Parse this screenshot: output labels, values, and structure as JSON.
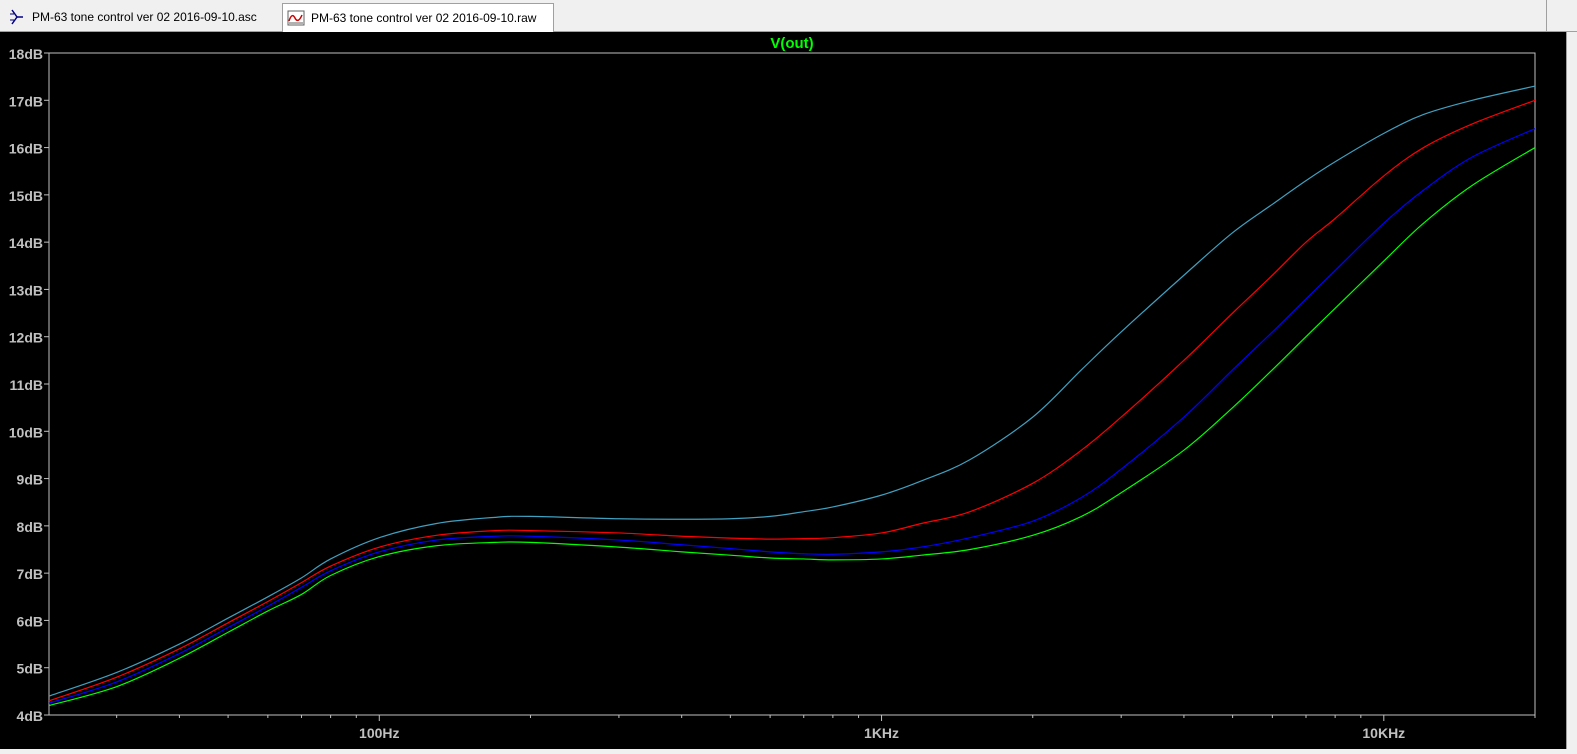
{
  "tabs": [
    {
      "label": "PM-63 tone control ver 02 2016-09-10.asc",
      "icon": "schematic-icon",
      "active": false
    },
    {
      "label": "PM-63 tone control ver 02 2016-09-10.raw",
      "icon": "waveform-icon",
      "active": true
    }
  ],
  "colors": {
    "plot_background": "#000000",
    "axis_color": "#c0c0c0",
    "tick_label_color": "#c0c0c0",
    "title_color": "#00ff00"
  },
  "chart_data": {
    "type": "line",
    "title": "V(out)",
    "xscale": "log",
    "xlim": [
      22,
      20000
    ],
    "ylim": [
      4,
      18
    ],
    "grid": false,
    "x_ticks": [
      {
        "value": 100,
        "label": "100Hz"
      },
      {
        "value": 1000,
        "label": "1KHz"
      },
      {
        "value": 10000,
        "label": "10KHz"
      }
    ],
    "y_ticks": [
      {
        "value": 4,
        "label": "4dB"
      },
      {
        "value": 5,
        "label": "5dB"
      },
      {
        "value": 6,
        "label": "6dB"
      },
      {
        "value": 7,
        "label": "7dB"
      },
      {
        "value": 8,
        "label": "8dB"
      },
      {
        "value": 9,
        "label": "9dB"
      },
      {
        "value": 10,
        "label": "10dB"
      },
      {
        "value": 11,
        "label": "11dB"
      },
      {
        "value": 12,
        "label": "12dB"
      },
      {
        "value": 13,
        "label": "13dB"
      },
      {
        "value": 14,
        "label": "14dB"
      },
      {
        "value": 15,
        "label": "15dB"
      },
      {
        "value": 16,
        "label": "16dB"
      },
      {
        "value": 17,
        "label": "17dB"
      },
      {
        "value": 18,
        "label": "18dB"
      }
    ],
    "series": [
      {
        "color": "#40a0c0",
        "points": [
          [
            22,
            4.4
          ],
          [
            30,
            4.9
          ],
          [
            40,
            5.5
          ],
          [
            50,
            6.05
          ],
          [
            60,
            6.5
          ],
          [
            70,
            6.9
          ],
          [
            80,
            7.3
          ],
          [
            100,
            7.75
          ],
          [
            130,
            8.05
          ],
          [
            170,
            8.18
          ],
          [
            200,
            8.2
          ],
          [
            300,
            8.15
          ],
          [
            400,
            8.14
          ],
          [
            500,
            8.15
          ],
          [
            600,
            8.2
          ],
          [
            700,
            8.3
          ],
          [
            800,
            8.4
          ],
          [
            1000,
            8.65
          ],
          [
            1200,
            8.95
          ],
          [
            1500,
            9.4
          ],
          [
            2000,
            10.3
          ],
          [
            2500,
            11.3
          ],
          [
            3000,
            12.1
          ],
          [
            4000,
            13.3
          ],
          [
            5000,
            14.2
          ],
          [
            6000,
            14.8
          ],
          [
            7000,
            15.3
          ],
          [
            8000,
            15.7
          ],
          [
            10000,
            16.3
          ],
          [
            12000,
            16.7
          ],
          [
            15000,
            17.0
          ],
          [
            20000,
            17.3
          ]
        ]
      },
      {
        "color": "#ff0000",
        "points": [
          [
            22,
            4.3
          ],
          [
            30,
            4.8
          ],
          [
            40,
            5.4
          ],
          [
            50,
            5.95
          ],
          [
            60,
            6.4
          ],
          [
            70,
            6.8
          ],
          [
            80,
            7.15
          ],
          [
            100,
            7.55
          ],
          [
            130,
            7.8
          ],
          [
            170,
            7.9
          ],
          [
            200,
            7.9
          ],
          [
            300,
            7.85
          ],
          [
            400,
            7.78
          ],
          [
            500,
            7.74
          ],
          [
            600,
            7.72
          ],
          [
            700,
            7.73
          ],
          [
            800,
            7.75
          ],
          [
            1000,
            7.85
          ],
          [
            1200,
            8.05
          ],
          [
            1500,
            8.3
          ],
          [
            2000,
            8.9
          ],
          [
            2500,
            9.6
          ],
          [
            3000,
            10.3
          ],
          [
            4000,
            11.5
          ],
          [
            5000,
            12.5
          ],
          [
            6000,
            13.3
          ],
          [
            7000,
            14.0
          ],
          [
            8000,
            14.5
          ],
          [
            10000,
            15.4
          ],
          [
            12000,
            16.0
          ],
          [
            15000,
            16.5
          ],
          [
            20000,
            17.0
          ]
        ]
      },
      {
        "color": "#0000ff",
        "points": [
          [
            22,
            4.25
          ],
          [
            30,
            4.7
          ],
          [
            40,
            5.3
          ],
          [
            50,
            5.85
          ],
          [
            60,
            6.3
          ],
          [
            70,
            6.7
          ],
          [
            80,
            7.05
          ],
          [
            100,
            7.45
          ],
          [
            130,
            7.7
          ],
          [
            170,
            7.78
          ],
          [
            200,
            7.78
          ],
          [
            300,
            7.7
          ],
          [
            400,
            7.6
          ],
          [
            500,
            7.52
          ],
          [
            600,
            7.45
          ],
          [
            700,
            7.41
          ],
          [
            800,
            7.4
          ],
          [
            1000,
            7.45
          ],
          [
            1200,
            7.55
          ],
          [
            1500,
            7.75
          ],
          [
            2000,
            8.1
          ],
          [
            2500,
            8.6
          ],
          [
            3000,
            9.2
          ],
          [
            4000,
            10.3
          ],
          [
            5000,
            11.3
          ],
          [
            6000,
            12.1
          ],
          [
            7000,
            12.8
          ],
          [
            8000,
            13.4
          ],
          [
            10000,
            14.4
          ],
          [
            12000,
            15.1
          ],
          [
            15000,
            15.8
          ],
          [
            20000,
            16.4
          ]
        ]
      },
      {
        "color": "#00ff00",
        "points": [
          [
            22,
            4.2
          ],
          [
            30,
            4.6
          ],
          [
            40,
            5.2
          ],
          [
            50,
            5.75
          ],
          [
            60,
            6.2
          ],
          [
            70,
            6.55
          ],
          [
            80,
            6.95
          ],
          [
            100,
            7.35
          ],
          [
            130,
            7.58
          ],
          [
            170,
            7.65
          ],
          [
            200,
            7.65
          ],
          [
            300,
            7.55
          ],
          [
            400,
            7.45
          ],
          [
            500,
            7.38
          ],
          [
            600,
            7.32
          ],
          [
            700,
            7.3
          ],
          [
            800,
            7.28
          ],
          [
            1000,
            7.3
          ],
          [
            1200,
            7.38
          ],
          [
            1500,
            7.5
          ],
          [
            2000,
            7.8
          ],
          [
            2500,
            8.2
          ],
          [
            3000,
            8.7
          ],
          [
            4000,
            9.6
          ],
          [
            5000,
            10.5
          ],
          [
            6000,
            11.3
          ],
          [
            7000,
            12.0
          ],
          [
            8000,
            12.6
          ],
          [
            10000,
            13.6
          ],
          [
            12000,
            14.4
          ],
          [
            15000,
            15.2
          ],
          [
            20000,
            16.0
          ]
        ]
      }
    ]
  }
}
